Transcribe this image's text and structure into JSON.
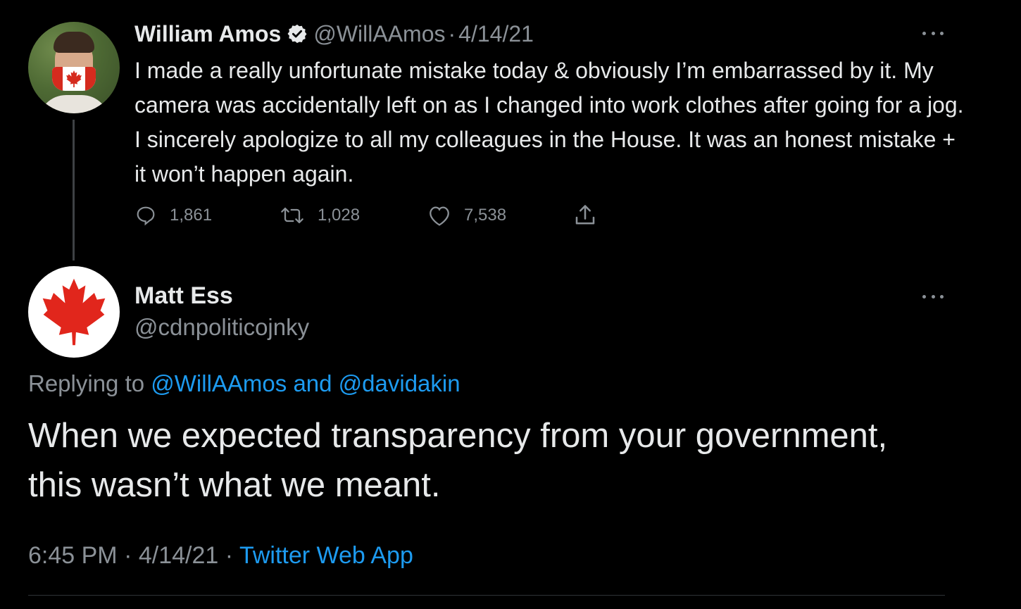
{
  "parent_tweet": {
    "display_name": "William Amos",
    "handle": "@WillAAmos",
    "separator": "·",
    "date": "4/14/21",
    "text": "I made a really unfortunate mistake today & obviously I’m embarrassed by it. My camera was accidentally left on as I changed into work clothes after going for a jog. I sincerely apologize to all my colleagues in the House. It was an honest mistake + it won’t happen again.",
    "replies": "1,861",
    "retweets": "1,028",
    "likes": "7,538",
    "icons": [
      "verified-badge-icon",
      "more-icon",
      "reply-icon",
      "retweet-icon",
      "like-icon",
      "share-icon"
    ]
  },
  "reply_tweet": {
    "display_name": "Matt Ess",
    "handle": "@cdnpoliticojnky",
    "replying_prefix": "Replying to ",
    "replying_to": "@WillAAmos and @davidakin",
    "text": "When we expected transparency from your government, this wasn’t what we meant.",
    "time": "6:45 PM",
    "date": "4/14/21",
    "separator": "·",
    "source": "Twitter Web App"
  },
  "colors": {
    "background": "#000000",
    "text": "#e7e9ea",
    "secondary": "#8b9197",
    "link": "#1d9bf0",
    "flag_red": "#d52b1e"
  }
}
